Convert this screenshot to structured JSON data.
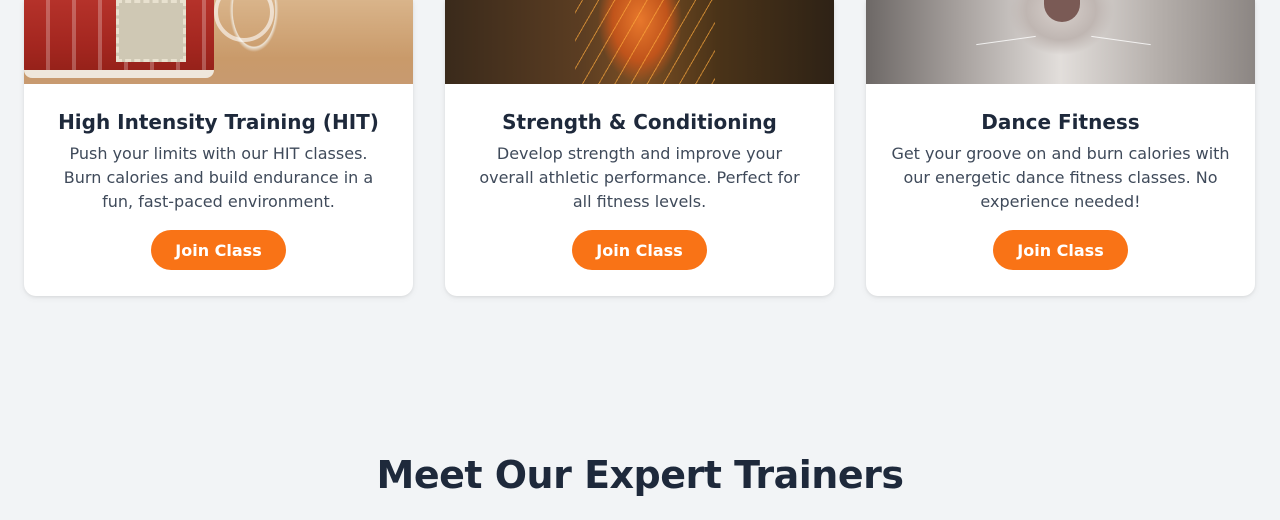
{
  "classes": [
    {
      "title": "High Intensity Training (HIT)",
      "description": "Push your limits with our HIT classes. Burn calories and build endurance in a fun, fast-paced environment.",
      "button_label": "Join Class"
    },
    {
      "title": "Strength & Conditioning",
      "description": "Develop strength and improve your overall athletic performance. Perfect for all fitness levels.",
      "button_label": "Join Class"
    },
    {
      "title": "Dance Fitness",
      "description": "Get your groove on and burn calories with our energetic dance fitness classes. No experience needed!",
      "button_label": "Join Class"
    }
  ],
  "trainers_section": {
    "title": "Meet Our Expert Trainers"
  },
  "colors": {
    "accent": "#f97316",
    "heading": "#1e293b",
    "background": "#f2f4f6"
  }
}
